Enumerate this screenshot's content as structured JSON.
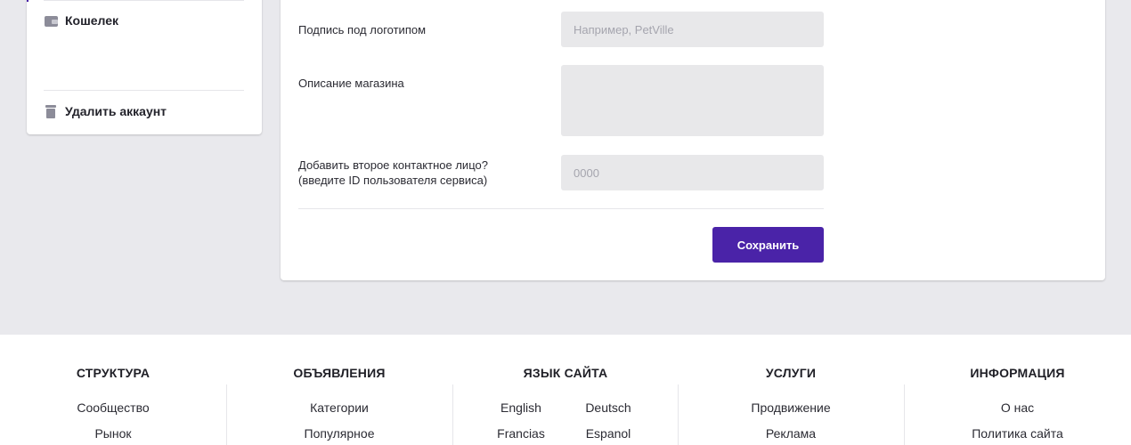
{
  "sidebar": {
    "wallet_label": "Кошелек",
    "delete_label": "Удалить аккаунт"
  },
  "form": {
    "logo_caption_label": "Подпись под логотипом",
    "logo_caption_placeholder": "Например, PetVille",
    "logo_caption_value": "",
    "description_label": "Описание магазина",
    "description_value": "",
    "second_contact_label_line1": "Добавить второе контактное лицо?",
    "second_contact_label_line2": "(введите ID пользователя сервиса)",
    "second_contact_placeholder": "0000",
    "second_contact_value": "",
    "save_label": "Сохранить"
  },
  "footer": {
    "columns": [
      {
        "title": "СТРУКТУРА",
        "links": [
          "Сообщество",
          "Рынок"
        ]
      },
      {
        "title": "ОБЪЯВЛЕНИЯ",
        "links": [
          "Категории",
          "Популярное"
        ]
      },
      {
        "title": "ЯЗЫК САЙТА",
        "links": [
          "English",
          "Deutsch",
          "Francias",
          "Espanol"
        ]
      },
      {
        "title": "УСЛУГИ",
        "links": [
          "Продвижение",
          "Реклама"
        ]
      },
      {
        "title": "ИНФОРМАЦИЯ",
        "links": [
          "О нас",
          "Политика сайта"
        ]
      }
    ]
  },
  "colors": {
    "accent": "#4a23a8",
    "page_background": "#e9e9ed",
    "field_background": "#e8e8ea"
  },
  "icons": [
    "wallet-icon",
    "trash-icon"
  ]
}
